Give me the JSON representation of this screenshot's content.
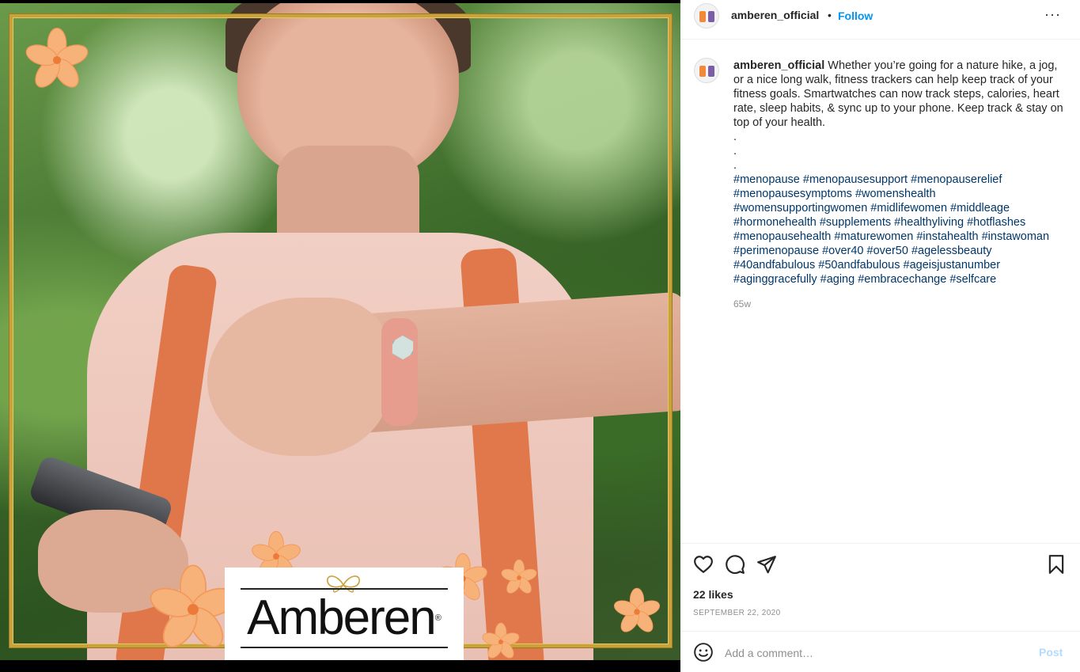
{
  "post": {
    "username": "amberen_official",
    "follow_label": "Follow",
    "separator": "•",
    "more_label": "···"
  },
  "image": {
    "brand_text": "Amberen",
    "brand_mark": "®"
  },
  "caption": {
    "username": "amberen_official",
    "text": " Whether you’re going for a nature hike, a jog, or a nice long walk, fitness trackers can help keep track of your fitness goals. Smartwatches can now track steps, calories, heart rate, sleep habits, & sync up to your phone. Keep track & stay on top of your health.",
    "dots": [
      ".",
      ".",
      "."
    ],
    "hashtags": [
      "#menopause",
      "#menopausesupport",
      "#menopauserelief",
      "#menopausesymptoms",
      "#womenshealth",
      "#womensupportingwomen",
      "#midlifewomen",
      "#middleage",
      "#hormonehealth",
      "#supplements",
      "#healthyliving",
      "#hotflashes",
      "#menopausehealth",
      "#maturewomen",
      "#instahealth",
      "#instawoman",
      "#perimenopause",
      "#over40",
      "#over50",
      "#agelessbeauty",
      "#40andfabulous",
      "#50andfabulous",
      "#ageisjustanumber",
      "#aginggracefully",
      "#aging",
      "#embracechange",
      "#selfcare"
    ],
    "time_ago": "65w"
  },
  "actions": {
    "like_icon": "heart-icon",
    "comment_icon": "comment-icon",
    "share_icon": "paper-plane-icon",
    "save_icon": "bookmark-icon",
    "likes": "22 likes",
    "date": "SEPTEMBER 22, 2020"
  },
  "comment": {
    "emoji_icon": "smiley-icon",
    "placeholder": "Add a comment…",
    "post_label": "Post"
  },
  "colors": {
    "link_blue": "#0095f6",
    "hashtag_blue": "#00376b",
    "post_disabled": "#b3dbff",
    "gold_frame": "#c9a23a",
    "flower_peach": "#f7b27a"
  }
}
